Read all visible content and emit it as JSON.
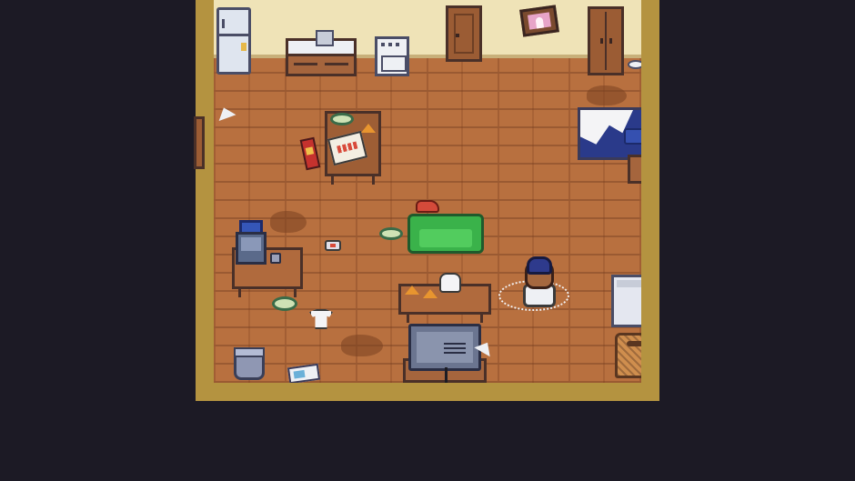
{
  "scene": {
    "type": "top-down pixel-art room",
    "colors": {
      "background": "#1c1a25",
      "wall_trim": "#b49340",
      "wall": "#efe3b7",
      "floor": "#b8703f",
      "sofa": "#3ab24a",
      "bed_blanket": "#2a3a8a",
      "player_hair": "#2e3a8c"
    },
    "icons": [
      "fridge-icon",
      "sink-counter-icon",
      "stove-icon",
      "door-icon",
      "picture-frame-icon",
      "wardrobe-icon",
      "bed-icon",
      "dining-table-icon",
      "sofa-icon",
      "computer-desk-icon",
      "coffee-table-icon",
      "tv-icon",
      "washing-machine-icon",
      "laundry-basket-icon",
      "trash-can-icon",
      "player-character-icon"
    ]
  }
}
